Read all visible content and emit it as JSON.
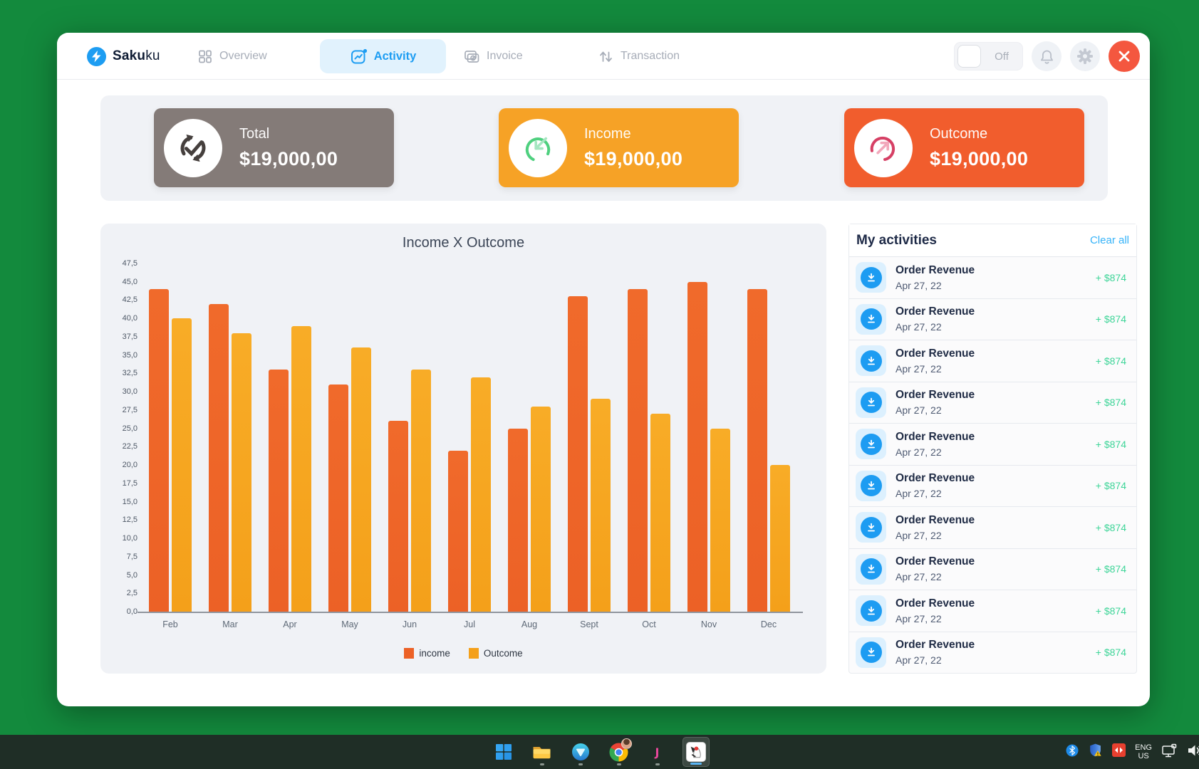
{
  "chart_data": {
    "type": "bar",
    "title": "Income X Outcome",
    "categories": [
      "Feb",
      "Mar",
      "Apr",
      "May",
      "Jun",
      "Jul",
      "Aug",
      "Sept",
      "Oct",
      "Nov",
      "Dec"
    ],
    "series": [
      {
        "name": "income",
        "color": "#EC6126",
        "color_top": "#F06A2B",
        "values": [
          44,
          42,
          33,
          31,
          26,
          22,
          25,
          43,
          44,
          45,
          44
        ]
      },
      {
        "name": "Outcome",
        "color": "#F4A01A",
        "color_top": "#F8AC27",
        "values": [
          40,
          38,
          39,
          36,
          33,
          32,
          28,
          29,
          27,
          25,
          20
        ]
      }
    ],
    "ylim": [
      0,
      47.5
    ],
    "ytick_step": 2.5,
    "ytick_labels": [
      "0,0",
      "2,5",
      "5,0",
      "7,5",
      "10,0",
      "12,5",
      "15,0",
      "17,5",
      "20,0",
      "22,5",
      "25,0",
      "27,5",
      "30,0",
      "32,5",
      "35,0",
      "37,5",
      "40,0",
      "42,5",
      "45,0",
      "47,5"
    ],
    "legend_position": "bottom",
    "grid": false
  },
  "app": {
    "brand": {
      "bold": "Saku",
      "light": "ku"
    },
    "nav": {
      "overview": "Overview",
      "activity": "Activity",
      "invoice": "Invoice",
      "transaction": "Transaction"
    },
    "toggle": {
      "label": "Off",
      "state": "off"
    },
    "cards": [
      {
        "title": "Total",
        "amount": "$19,000,00",
        "bg": "#847B78",
        "icon": "refresh-check-icon"
      },
      {
        "title": "Income",
        "amount": "$19,000,00",
        "bg": "#F6A226",
        "icon": "arrow-in-circle-icon"
      },
      {
        "title": "Outcome",
        "amount": "$19,000,00",
        "bg": "#F15D2D",
        "icon": "arrow-out-circle-icon"
      }
    ],
    "activities": {
      "title": "My activities",
      "clear_label": "Clear all",
      "items": [
        {
          "title": "Order Revenue",
          "date": "Apr 27, 22",
          "amount": "+ $874"
        },
        {
          "title": "Order Revenue",
          "date": "Apr 27, 22",
          "amount": "+ $874"
        },
        {
          "title": "Order Revenue",
          "date": "Apr 27, 22",
          "amount": "+ $874"
        },
        {
          "title": "Order Revenue",
          "date": "Apr 27, 22",
          "amount": "+ $874"
        },
        {
          "title": "Order Revenue",
          "date": "Apr 27, 22",
          "amount": "+ $874"
        },
        {
          "title": "Order Revenue",
          "date": "Apr 27, 22",
          "amount": "+ $874"
        },
        {
          "title": "Order Revenue",
          "date": "Apr 27, 22",
          "amount": "+ $874"
        },
        {
          "title": "Order Revenue",
          "date": "Apr 27, 22",
          "amount": "+ $874"
        },
        {
          "title": "Order Revenue",
          "date": "Apr 27, 22",
          "amount": "+ $874"
        },
        {
          "title": "Order Revenue",
          "date": "Apr 27, 22",
          "amount": "+ $874"
        }
      ]
    }
  },
  "taskbar": {
    "language": {
      "line1": "ENG",
      "line2": "US"
    },
    "pinned_icons": [
      "windows-start",
      "file-explorer",
      "triangle-browser",
      "chrome",
      "j-app",
      "java-duke"
    ],
    "tray_icons": [
      "bluetooth",
      "security-shield",
      "red-app",
      "language-indicator",
      "display",
      "speaker"
    ],
    "colors": {
      "bar": "#1F2E26",
      "desktop": "#138A3D",
      "active_underline": "#5AB6F5"
    }
  }
}
